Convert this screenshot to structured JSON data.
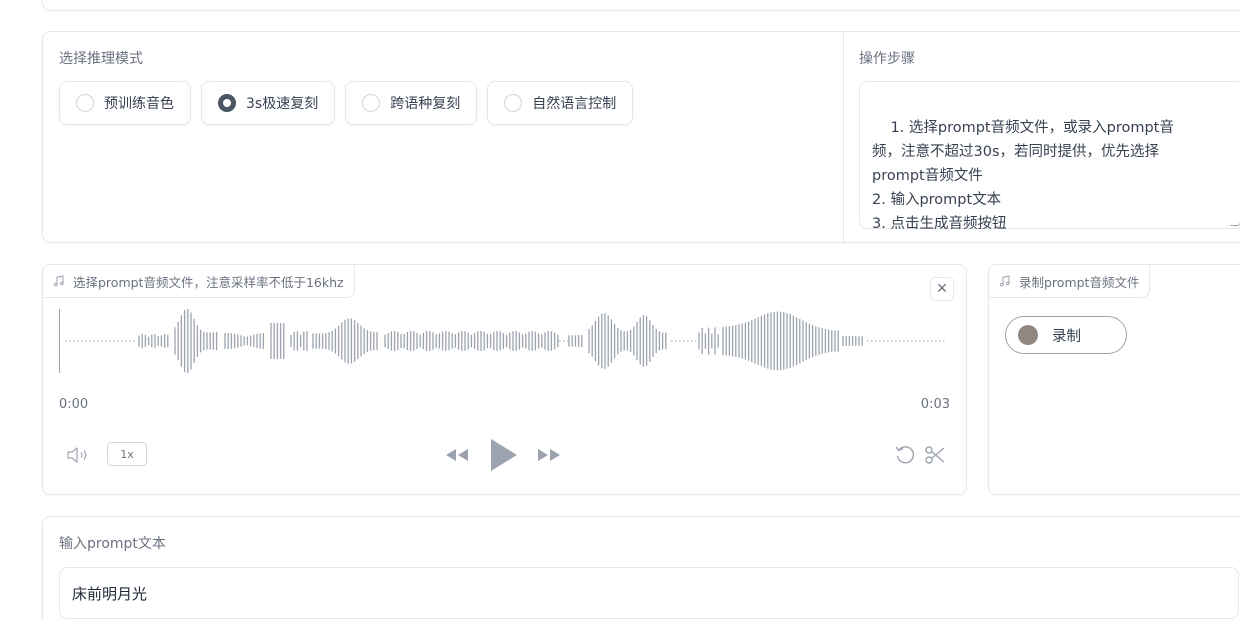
{
  "mode_section": {
    "label": "选择推理模式",
    "options": [
      {
        "label": "预训练音色",
        "checked": false
      },
      {
        "label": "3s极速复刻",
        "checked": true
      },
      {
        "label": "跨语种复刻",
        "checked": false
      },
      {
        "label": "自然语言控制",
        "checked": false
      }
    ]
  },
  "steps_section": {
    "label": "操作步骤",
    "text": "1. 选择prompt音频文件，或录入prompt音\n频，注意不超过30s，若同时提供，优先选择\nprompt音频文件\n2. 输入prompt文本\n3. 点击生成音频按钮"
  },
  "audio_upload": {
    "label": "选择prompt音频文件，注意采样率不低于16khz",
    "current_time": "0:00",
    "duration": "0:03",
    "speed": "1x",
    "icons": [
      "music-note-icon",
      "close-icon",
      "volume-icon",
      "rewind-icon",
      "play-icon",
      "fast-forward-icon",
      "undo-icon",
      "scissors-icon"
    ]
  },
  "audio_record": {
    "label": "录制prompt音频文件",
    "record_label": "录制"
  },
  "prompt_text": {
    "label": "输入prompt文本",
    "value": "床前明月光"
  },
  "colors": {
    "border": "#e5e7eb",
    "text": "#374151",
    "muted": "#6b7280",
    "waveform": "#9ca3af",
    "record_dot": "#928682"
  }
}
